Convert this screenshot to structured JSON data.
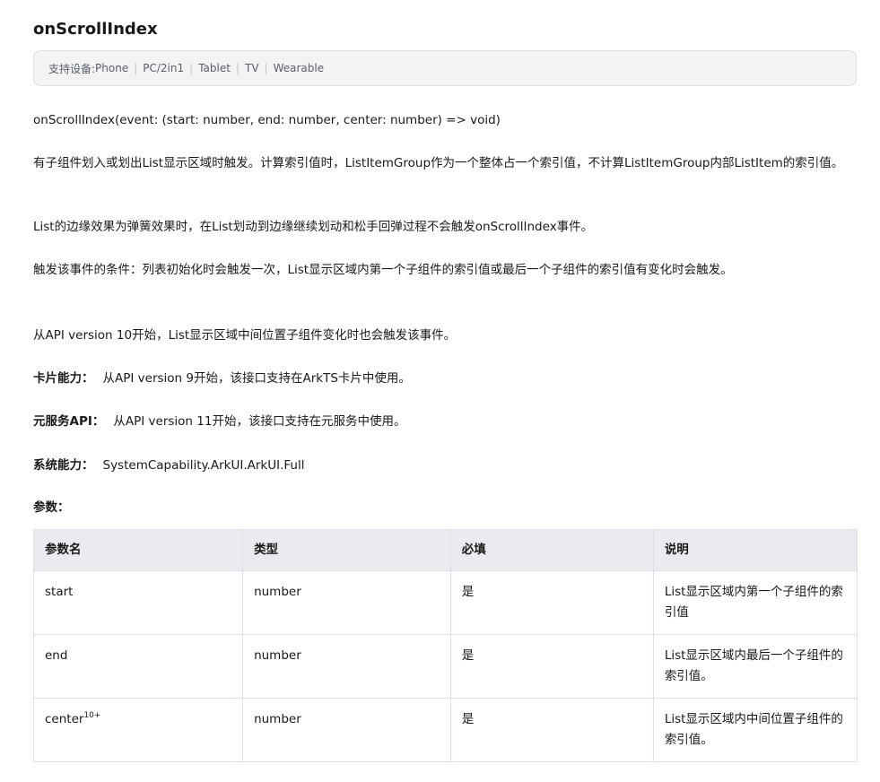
{
  "page": {
    "title": "onScrollIndex",
    "devices": {
      "label": "支持设备: ",
      "items": [
        "Phone",
        "PC/2in1",
        "Tablet",
        "TV",
        "Wearable"
      ]
    },
    "signature": "onScrollIndex(event: (start: number, end: number, center: number) => void)",
    "desc1": "有子组件划入或划出List显示区域时触发。计算索引值时，ListItemGroup作为一个整体占一个索引值，不计算ListItemGroup内部ListItem的索引值。",
    "desc2": "List的边缘效果为弹簧效果时，在List划动到边缘继续划动和松手回弹过程不会触发onScrollIndex事件。",
    "desc3": "触发该事件的条件：列表初始化时会触发一次，List显示区域内第一个子组件的索引值或最后一个子组件的索引值有变化时会触发。",
    "desc4": "从API version 10开始，List显示区域中间位置子组件变化时也会触发该事件。",
    "card": {
      "label": "卡片能力：",
      "text": "从API version 9开始，该接口支持在ArkTS卡片中使用。"
    },
    "atomic": {
      "label": "元服务API：",
      "text": "从API version 11开始，该接口支持在元服务中使用。"
    },
    "syscap": {
      "label": "系统能力：",
      "text": "SystemCapability.ArkUI.ArkUI.Full"
    },
    "params_label": "参数："
  },
  "table": {
    "headers": [
      "参数名",
      "类型",
      "必填",
      "说明"
    ],
    "rows": [
      {
        "name": "start",
        "sup": "",
        "type": "number",
        "required": "是",
        "desc": "List显示区域内第一个子组件的索引值"
      },
      {
        "name": "end",
        "sup": "",
        "type": "number",
        "required": "是",
        "desc": "List显示区域内最后一个子组件的索引值。"
      },
      {
        "name": "center",
        "sup": "10+",
        "type": "number",
        "required": "是",
        "desc": "List显示区域内中间位置子组件的索引值。"
      }
    ]
  }
}
